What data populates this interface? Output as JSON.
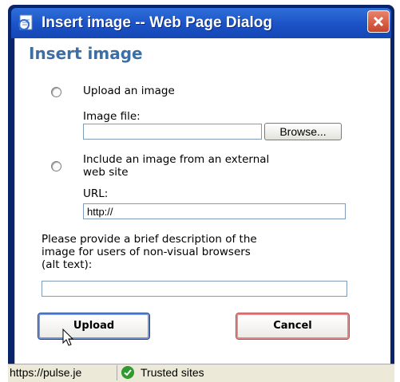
{
  "window": {
    "title": "Insert image -- Web Page Dialog"
  },
  "dialog": {
    "heading": "Insert image",
    "upload_option_label": "Upload an image",
    "image_file_label": "Image file:",
    "image_file_value": "",
    "browse_label": "Browse...",
    "external_option_label_line1": "Include an image from an external",
    "external_option_label_line2": "web site",
    "url_label": "URL:",
    "url_value": "http://",
    "alt_text_line1": "Please provide a brief description of the",
    "alt_text_line2": "image for users of non-visual browsers",
    "alt_text_line3": "(alt text):",
    "alt_text_value": "",
    "upload_button": "Upload",
    "cancel_button": "Cancel"
  },
  "status_bar": {
    "url": "https://pulse.je",
    "zone": "Trusted sites"
  },
  "colors": {
    "titlebar": "#1b52c6",
    "heading": "#3a6ea5",
    "close_button": "#c6452a"
  }
}
